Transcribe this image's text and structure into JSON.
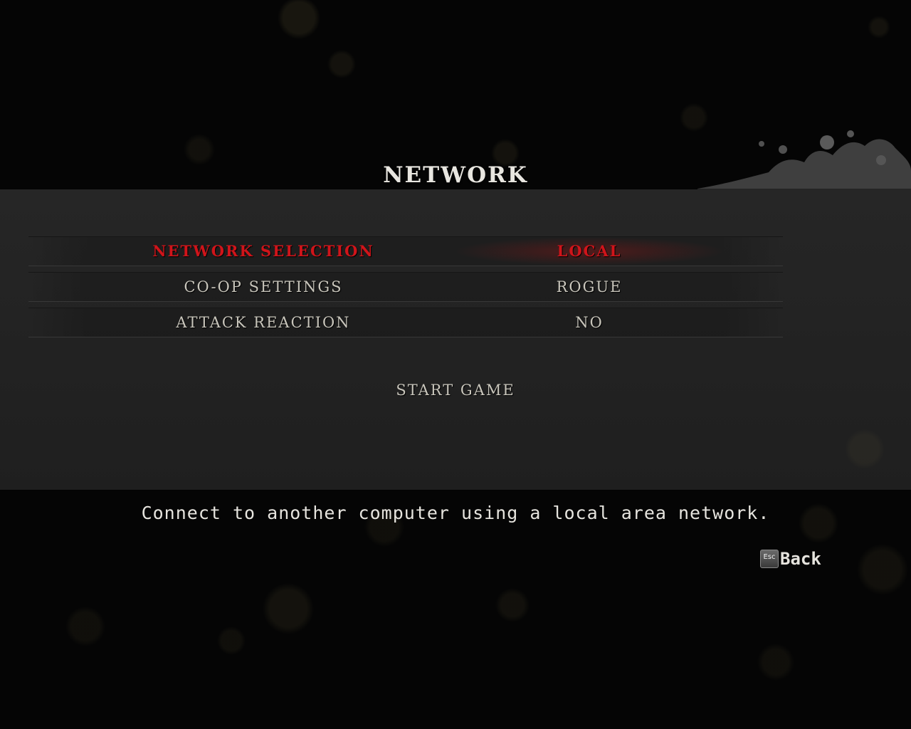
{
  "screen": {
    "title": "NETWORK",
    "accent_color": "#d0141a"
  },
  "settings": [
    {
      "label": "NETWORK SELECTION",
      "value": "LOCAL",
      "selected": true
    },
    {
      "label": "CO-OP SETTINGS",
      "value": "ROGUE",
      "selected": false
    },
    {
      "label": "ATTACK REACTION",
      "value": "NO",
      "selected": false
    }
  ],
  "start_game_label": "START GAME",
  "description": "Connect to another computer using a local area network.",
  "back": {
    "key_label": "Esc",
    "label": "Back"
  }
}
